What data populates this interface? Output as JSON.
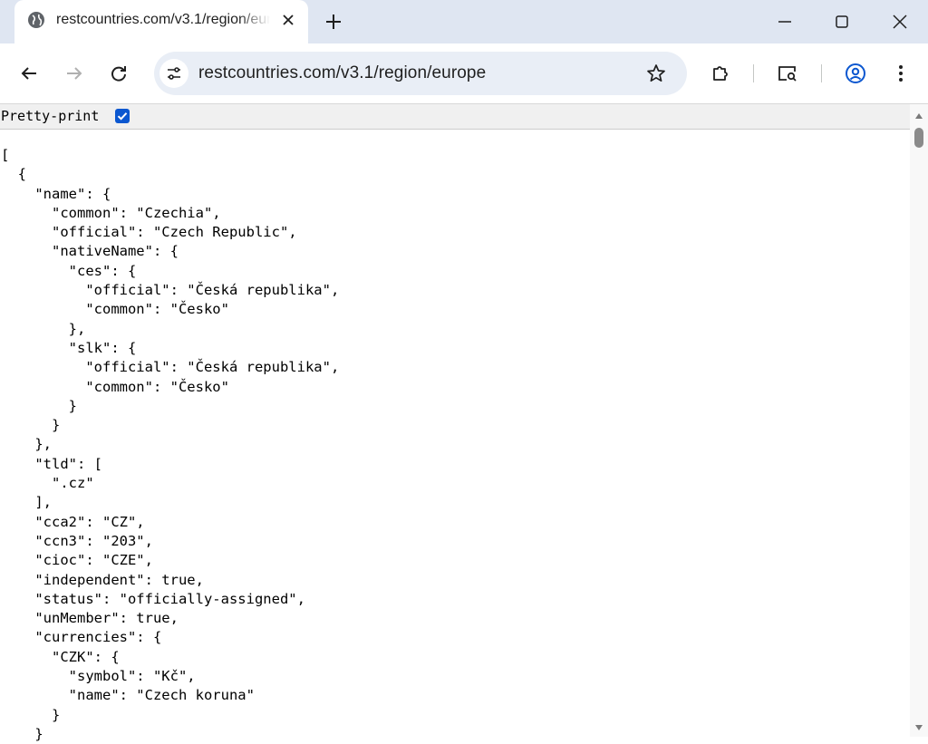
{
  "tab": {
    "title": "restcountries.com/v3.1/region/europe"
  },
  "toolbar": {
    "url": "restcountries.com/v3.1/region/europe"
  },
  "content": {
    "pretty_print_label": "Pretty-print",
    "pretty_print_checked": true,
    "json_lines": [
      "[",
      "  {",
      "    \"name\": {",
      "      \"common\": \"Czechia\",",
      "      \"official\": \"Czech Republic\",",
      "      \"nativeName\": {",
      "        \"ces\": {",
      "          \"official\": \"Česká republika\",",
      "          \"common\": \"Česko\"",
      "        },",
      "        \"slk\": {",
      "          \"official\": \"Česká republika\",",
      "          \"common\": \"Česko\"",
      "        }",
      "      }",
      "    },",
      "    \"tld\": [",
      "      \".cz\"",
      "    ],",
      "    \"cca2\": \"CZ\",",
      "    \"ccn3\": \"203\",",
      "    \"cioc\": \"CZE\",",
      "    \"independent\": true,",
      "    \"status\": \"officially-assigned\",",
      "    \"unMember\": true,",
      "    \"currencies\": {",
      "      \"CZK\": {",
      "        \"symbol\": \"Kč\",",
      "        \"name\": \"Czech koruna\"",
      "      }",
      "    }"
    ]
  },
  "colors": {
    "tabstrip_bg": "#dfe6f2",
    "omnibox_bg": "#e9eef6",
    "checkbox_accent": "#0b57d0",
    "profile_icon": "#0b57d0"
  },
  "icons": {
    "tab_favicon": "globe-icon",
    "tab_close": "close-icon",
    "new_tab": "plus-icon",
    "minimize": "minimize-icon",
    "maximize": "maximize-icon",
    "close_window": "close-window-icon",
    "back": "back-arrow-icon",
    "forward": "forward-arrow-icon",
    "reload": "reload-icon",
    "site_info": "tune-icon",
    "bookmark": "star-icon",
    "extensions": "puzzle-icon",
    "search_tabs": "search-tabs-icon",
    "profile": "profile-icon",
    "menu": "kebab-menu-icon"
  }
}
